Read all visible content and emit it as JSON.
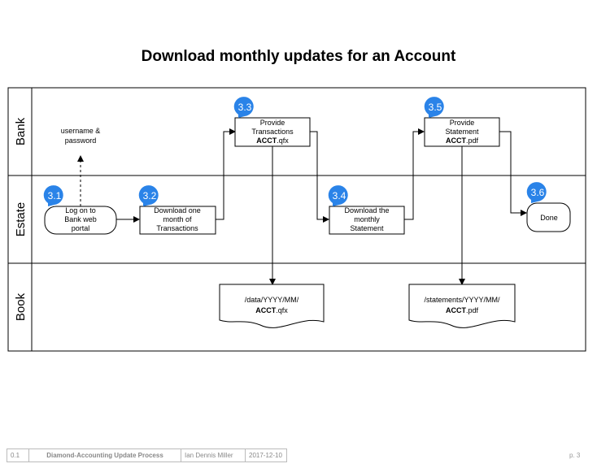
{
  "title": "Download monthly updates for an Account",
  "lanes": [
    "Bank",
    "Estate",
    "Book"
  ],
  "annotation": [
    "username &",
    "password"
  ],
  "steps": [
    {
      "id": "3.1",
      "lines": [
        "Log on to",
        "Bank web",
        "portal"
      ]
    },
    {
      "id": "3.2",
      "lines": [
        "Download one",
        "month of",
        "Transactions"
      ]
    },
    {
      "id": "3.3",
      "lines": [
        "Provide",
        "Transactions"
      ],
      "file_bold": "ACCT",
      "file_ext": ".qfx"
    },
    {
      "id": "3.4",
      "lines": [
        "Download the",
        "monthly",
        "Statement"
      ]
    },
    {
      "id": "3.5",
      "lines": [
        "Provide",
        "Statement"
      ],
      "file_bold": "ACCT",
      "file_ext": ".pdf"
    },
    {
      "id": "3.6",
      "lines": [
        "Done"
      ]
    }
  ],
  "documents": [
    {
      "path": "/data/YYYY/MM/",
      "file_bold": "ACCT",
      "file_ext": ".qfx"
    },
    {
      "path": "/statements/YYYY/MM/",
      "file_bold": "ACCT",
      "file_ext": ".pdf"
    }
  ],
  "footer": {
    "version": "0.1",
    "doc_title": "Diamond-Accounting Update Process",
    "author": "Ian Dennis Miller",
    "date": "2017-12-10",
    "page": "p. 3"
  },
  "colors": {
    "badge": "#2a83e8",
    "line": "#000000",
    "footer_text": "#888888"
  }
}
